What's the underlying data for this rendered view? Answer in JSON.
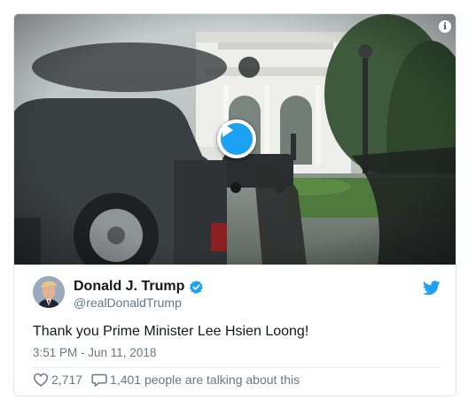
{
  "media": {
    "play_icon": "play-icon",
    "info_label": "i"
  },
  "tweet": {
    "author_name": "Donald J. Trump",
    "handle": "@realDonaldTrump",
    "text": "Thank you Prime Minister Lee Hsien Loong!",
    "timestamp": "3:51 PM - Jun 11, 2018",
    "likes": "2,717",
    "talking_about": "1,401 people are talking about this"
  },
  "icons": {
    "verified": "verified-badge-icon",
    "twitter": "twitter-bird-icon",
    "like": "heart-icon",
    "comment": "speech-bubble-icon"
  },
  "colors": {
    "accent": "#1da1f2",
    "text": "#14171a",
    "muted": "#657786",
    "border": "#e1e8ed"
  }
}
